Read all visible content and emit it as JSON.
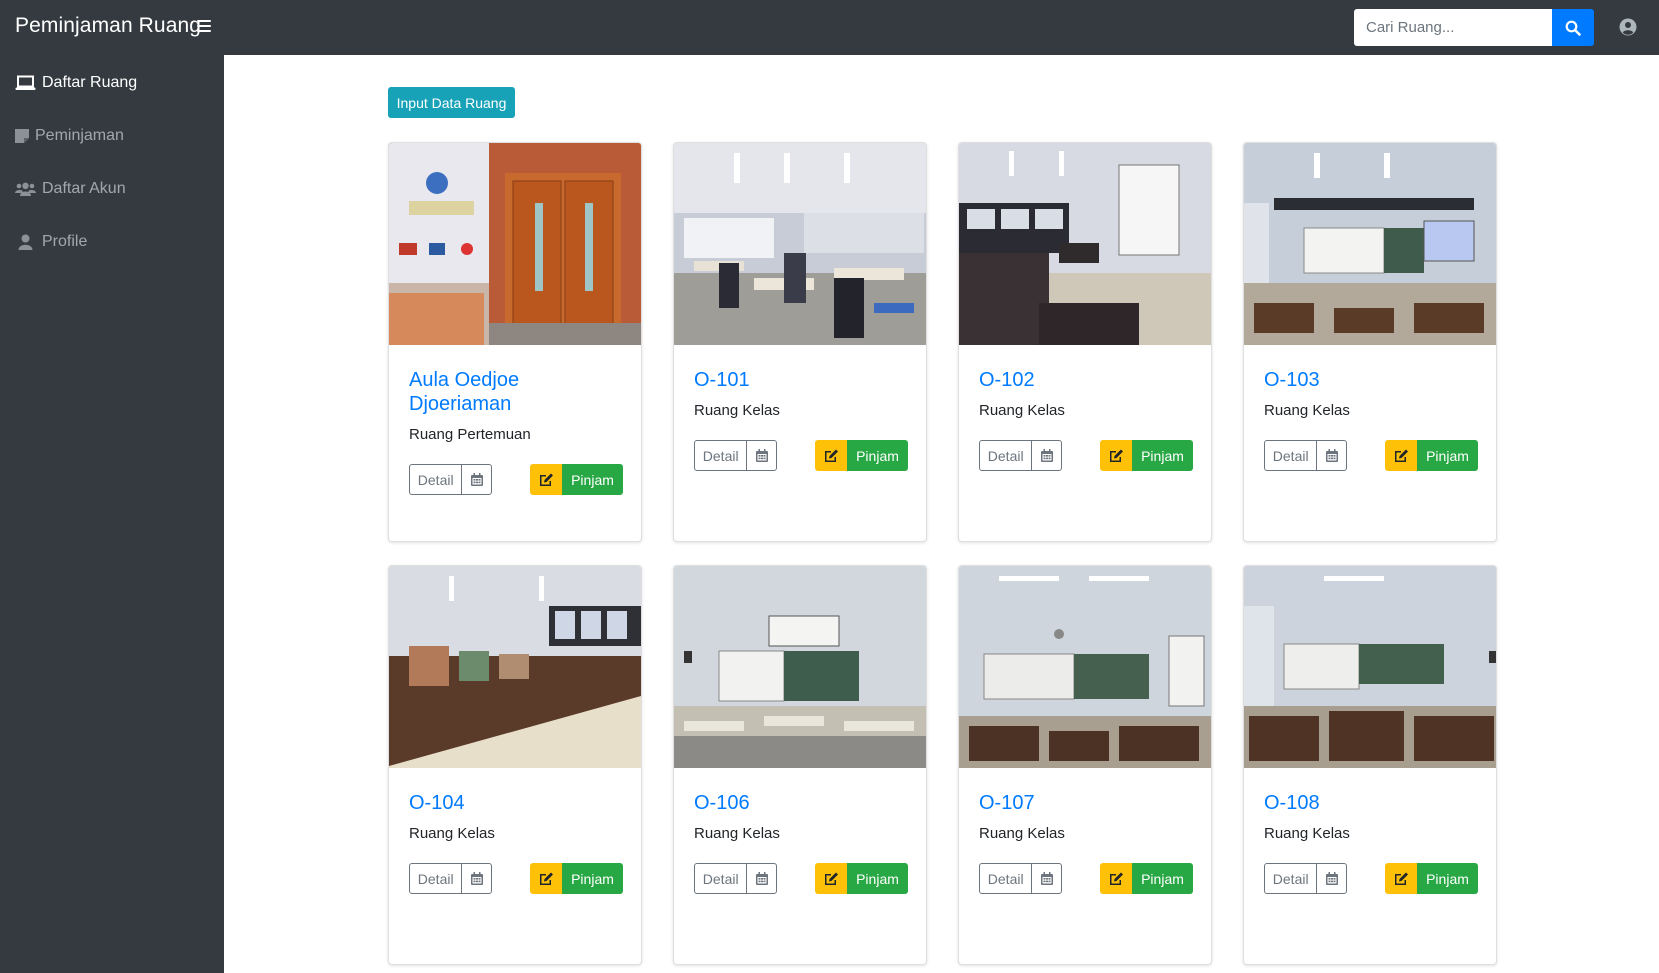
{
  "navbar": {
    "brand": "Peminjaman Ruang",
    "search_placeholder": "Cari Ruang..."
  },
  "sidebar": {
    "items": [
      {
        "label": "Daftar Ruang",
        "icon": "laptop-icon",
        "active": true
      },
      {
        "label": "Peminjaman",
        "icon": "sticky-note-icon",
        "active": false
      },
      {
        "label": "Daftar Akun",
        "icon": "users-icon",
        "active": false
      },
      {
        "label": "Profile",
        "icon": "user-icon",
        "active": false
      }
    ]
  },
  "main": {
    "input_button": "Input Data Ruang",
    "detail_label": "Detail",
    "pinjam_label": "Pinjam",
    "rooms": [
      {
        "name": "Aula Oedjoe Djoeriaman",
        "type": "Ruang Pertemuan"
      },
      {
        "name": "O-101",
        "type": "Ruang Kelas"
      },
      {
        "name": "O-102",
        "type": "Ruang Kelas"
      },
      {
        "name": "O-103",
        "type": "Ruang Kelas"
      },
      {
        "name": "O-104",
        "type": "Ruang Kelas"
      },
      {
        "name": "O-106",
        "type": "Ruang Kelas"
      },
      {
        "name": "O-107",
        "type": "Ruang Kelas"
      },
      {
        "name": "O-108",
        "type": "Ruang Kelas"
      }
    ]
  },
  "colors": {
    "navbar": "#343a40",
    "primary": "#007bff",
    "info": "#17a2b8",
    "warning": "#ffc107",
    "success": "#28a745"
  }
}
